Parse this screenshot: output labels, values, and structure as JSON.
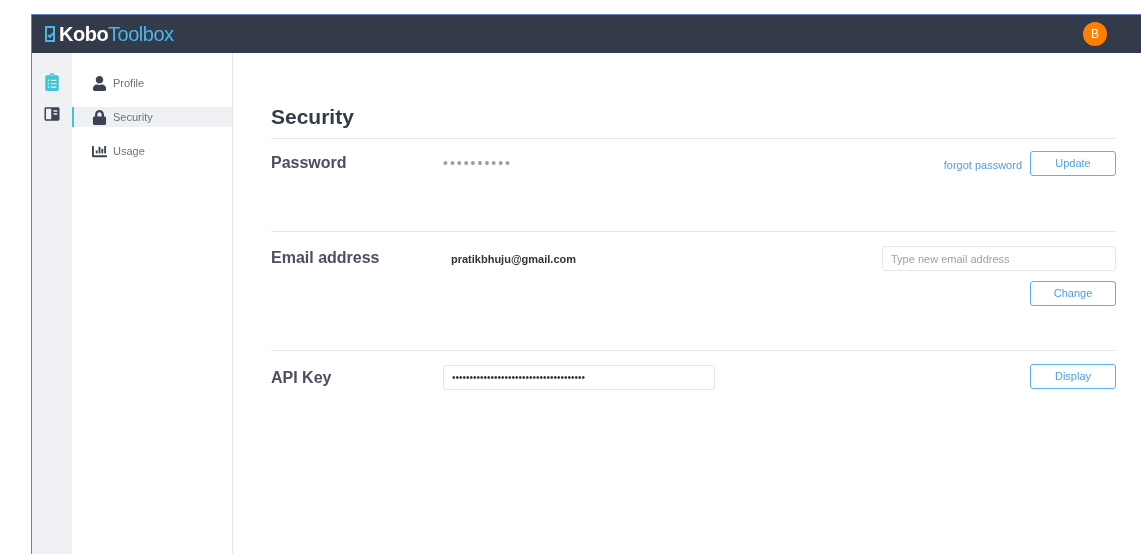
{
  "header": {
    "logo_prefix": "Kobo",
    "logo_suffix": "Toolbox",
    "avatar": "B"
  },
  "rail": [
    {
      "kind": "forms",
      "selected": true
    },
    {
      "kind": "library",
      "selected": false
    }
  ],
  "nav": [
    {
      "kind": "profile",
      "label": "Profile",
      "selected": false
    },
    {
      "kind": "security",
      "label": "Security",
      "selected": true
    },
    {
      "kind": "usage",
      "label": "Usage",
      "selected": false
    }
  ],
  "title": "Security",
  "password": {
    "label": "Password",
    "value": "••••••••••",
    "link": "forgot password",
    "button": "Update"
  },
  "email": {
    "label": "Email address",
    "value": "pratikbhuju@gmail.com",
    "placeholder": "Type new email address",
    "button": "Change"
  },
  "api_key": {
    "label": "API Key",
    "value": "••••••••••••••••••••••••••••••••••••••",
    "button": "Display"
  }
}
